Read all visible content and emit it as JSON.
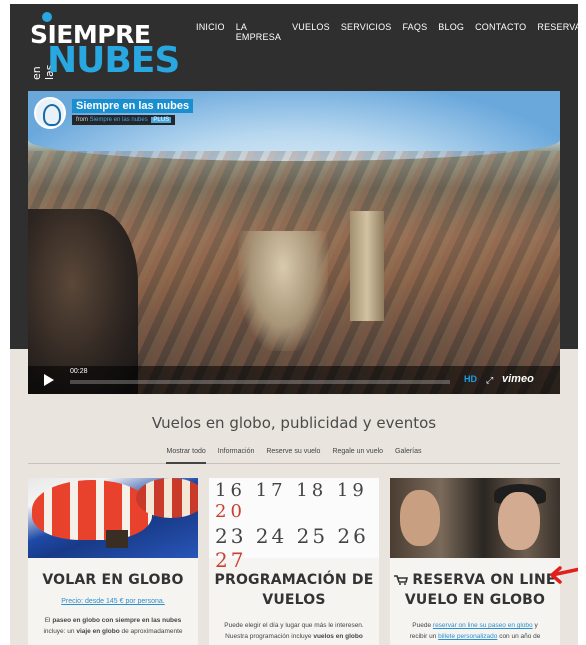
{
  "logo": {
    "line1": "SIEMPRE",
    "line2": "en las",
    "line3": "NUBES"
  },
  "nav": [
    "INICIO",
    "LA EMPRESA",
    "VUELOS",
    "SERVICIOS",
    "FAQS",
    "BLOG",
    "CONTACTO",
    "RESERVAS"
  ],
  "video": {
    "title": "Siempre en las nubes",
    "from_prefix": "from",
    "from_user": "Siempre en las nubes",
    "badge": "PLUS",
    "time": "00:28",
    "hd": "HD",
    "brand": "vimeo"
  },
  "headline": "Vuelos en globo, publicidad y eventos",
  "filters": [
    "Mostrar todo",
    "Información",
    "Reserve su vuelo",
    "Regale un vuelo",
    "Galerías"
  ],
  "cards": [
    {
      "title": "VOLAR EN GLOBO",
      "price": "Precio: desde 145 € por persona.",
      "text_1": "El ",
      "text_bold_1": "paseo en globo con siempre en las nubes",
      "text_2": " incluye: un ",
      "text_bold_2": "viaje en globo",
      "text_3": " de aproximadamente"
    },
    {
      "title_1": "PROGRAMACIÓN DE",
      "title_2": "VUELOS",
      "cal_row1": "16 17 18 19",
      "cal_row1_red": "20",
      "cal_row2": "23 24 25 26",
      "cal_row2_red": "27",
      "text_1": "Puede elegir el día y lugar que más le interesen.",
      "text_2": "Nuestra programación incluye ",
      "text_bold": "vuelos en globo"
    },
    {
      "title_1": "RESERVA ON LINE",
      "title_2": "VUELO EN GLOBO",
      "text_1": "Puede ",
      "link_1": "reservar on line su paseo en globo",
      "text_2": " y",
      "text_3": "recibir un ",
      "link_2": "billete personalizado",
      "text_4": " con un año de"
    }
  ]
}
